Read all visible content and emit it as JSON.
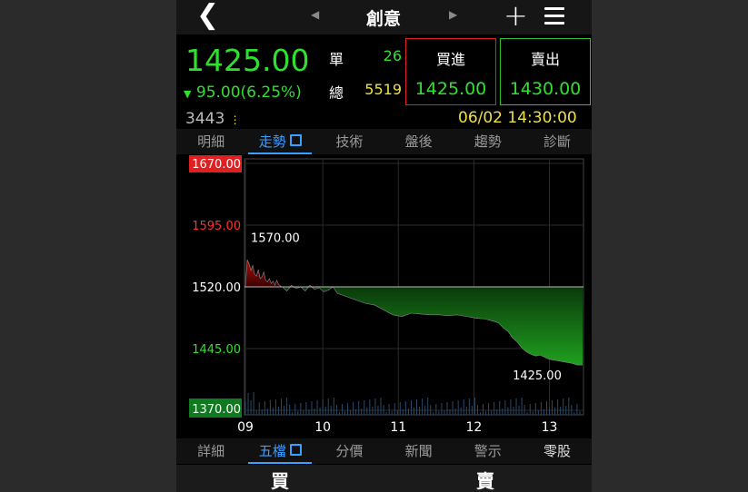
{
  "header": {
    "title": "創意",
    "back_icon": "chevron-left-icon",
    "prev_icon": "triangle-left-icon",
    "next_icon": "triangle-right-icon",
    "add_icon": "plus-icon",
    "menu_icon": "hamburger-icon"
  },
  "quote": {
    "price": "1425.00",
    "change": "95.00(6.25%)",
    "single_label": "單",
    "single_value": "26",
    "total_label": "總",
    "total_value": "5519",
    "buy_label": "買進",
    "buy_price": "1425.00",
    "sell_label": "賣出",
    "sell_price": "1430.00",
    "volume": "3443",
    "datetime": "06/02 14:30:00"
  },
  "tabs_top": [
    "明細",
    "走勢",
    "技術",
    "盤後",
    "趨勢",
    "診斷"
  ],
  "tabs_top_active": 1,
  "tabs_bottom": [
    "詳細",
    "五檔",
    "分價",
    "新聞",
    "警示",
    "零股"
  ],
  "tabs_bottom_active": 1,
  "bottom": {
    "buy": "買",
    "sell": "賣"
  },
  "colors": {
    "up": "#ff3030",
    "down": "#2fe02f",
    "accent": "#3aa0ff",
    "date": "#f0e040"
  },
  "chart_data": {
    "type": "area",
    "y_labels": [
      "1670.00",
      "1595.00",
      "1520.00",
      "1445.00",
      "1370.00"
    ],
    "ylim": [
      1370,
      1670
    ],
    "reference": 1520,
    "x_labels": [
      "09",
      "10",
      "11",
      "12",
      "13"
    ],
    "annotations": [
      {
        "text": "1570.00",
        "value": 1570
      },
      {
        "text": "1425.00",
        "value": 1425
      }
    ],
    "x": [
      0,
      2,
      4,
      6,
      8,
      10,
      12,
      14,
      16,
      18,
      20,
      22,
      24,
      26,
      28,
      30,
      32,
      34,
      36,
      38,
      40,
      45,
      50,
      55,
      60,
      65,
      70,
      75,
      80,
      85,
      90,
      95,
      100,
      110,
      120,
      130,
      140,
      150,
      160,
      170,
      180,
      190,
      200,
      210,
      220,
      230,
      240,
      250,
      260,
      270,
      275,
      280,
      285,
      290,
      295,
      300,
      305,
      310,
      315,
      320,
      330,
      340,
      350,
      355,
      360,
      365,
      366
    ],
    "values": [
      1520,
      1553,
      1548,
      1540,
      1546,
      1535,
      1533,
      1541,
      1530,
      1532,
      1538,
      1528,
      1526,
      1530,
      1524,
      1527,
      1522,
      1528,
      1523,
      1521,
      1520,
      1515,
      1522,
      1518,
      1520,
      1515,
      1522,
      1517,
      1519,
      1514,
      1516,
      1520,
      1512,
      1508,
      1504,
      1500,
      1498,
      1492,
      1486,
      1484,
      1488,
      1487,
      1486,
      1486,
      1485,
      1486,
      1484,
      1482,
      1481,
      1478,
      1476,
      1470,
      1466,
      1458,
      1453,
      1446,
      1441,
      1438,
      1436,
      1437,
      1432,
      1430,
      1428,
      1427,
      1425,
      1425,
      1425
    ]
  }
}
